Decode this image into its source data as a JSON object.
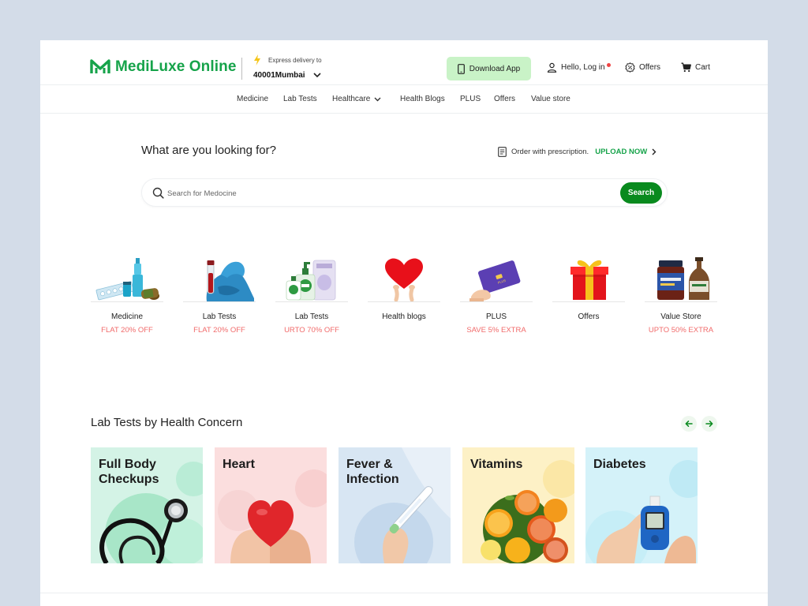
{
  "brand": {
    "name": "MediLuxe Online",
    "color": "#16a34a"
  },
  "delivery": {
    "label": "Express delivery to",
    "pincode": "40001Mumbai"
  },
  "header": {
    "download_label": "Download App",
    "login_label": "Hello, Log in",
    "offers_label": "Offers",
    "cart_label": "Cart"
  },
  "nav": {
    "items": [
      "Medicine",
      "Lab Tests",
      "Healthcare",
      "Health Blogs",
      "PLUS",
      "Offers",
      "Value store"
    ]
  },
  "search": {
    "question": "What are you looking for?",
    "prescription_label": "Order with prescription.",
    "upload_label": "UPLOAD NOW",
    "placeholder": "Search for Medocine",
    "button_label": "Search"
  },
  "categories": [
    {
      "name": "Medicine",
      "offer": "FLAT 20% OFF",
      "icon": "medicine-image"
    },
    {
      "name": "Lab Tests",
      "offer": "FLAT 20% OFF",
      "icon": "lab-tests-image"
    },
    {
      "name": "Lab Tests",
      "offer": "URTO 70% OFF",
      "icon": "healthcare-products-image"
    },
    {
      "name": "Health blogs",
      "offer": "",
      "icon": "heart-image"
    },
    {
      "name": "PLUS",
      "offer": "SAVE 5% EXTRA",
      "icon": "plus-card-image"
    },
    {
      "name": "Offers",
      "offer": "",
      "icon": "gift-image"
    },
    {
      "name": "Value Store",
      "offer": "UPTO 50% EXTRA",
      "icon": "value-store-image"
    }
  ],
  "lab_tests": {
    "title": "Lab Tests by Health Concern",
    "concerns": [
      {
        "line1": "Full Body",
        "line2": "Checkups",
        "icon": "stethoscope-image"
      },
      {
        "line1": "Heart",
        "line2": "",
        "icon": "heart-in-hands-image"
      },
      {
        "line1": "Fever &",
        "line2": "Infection",
        "icon": "thermometer-image"
      },
      {
        "line1": "Vitamins",
        "line2": "",
        "icon": "citrus-fruits-image"
      },
      {
        "line1": "Diabetes",
        "line2": "",
        "icon": "glucometer-image"
      }
    ]
  },
  "colors": {
    "accent": "#16a34a",
    "button_dark": "#098a1e",
    "offer_text": "#f16b6b",
    "download_bg": "#c9f3c7"
  }
}
